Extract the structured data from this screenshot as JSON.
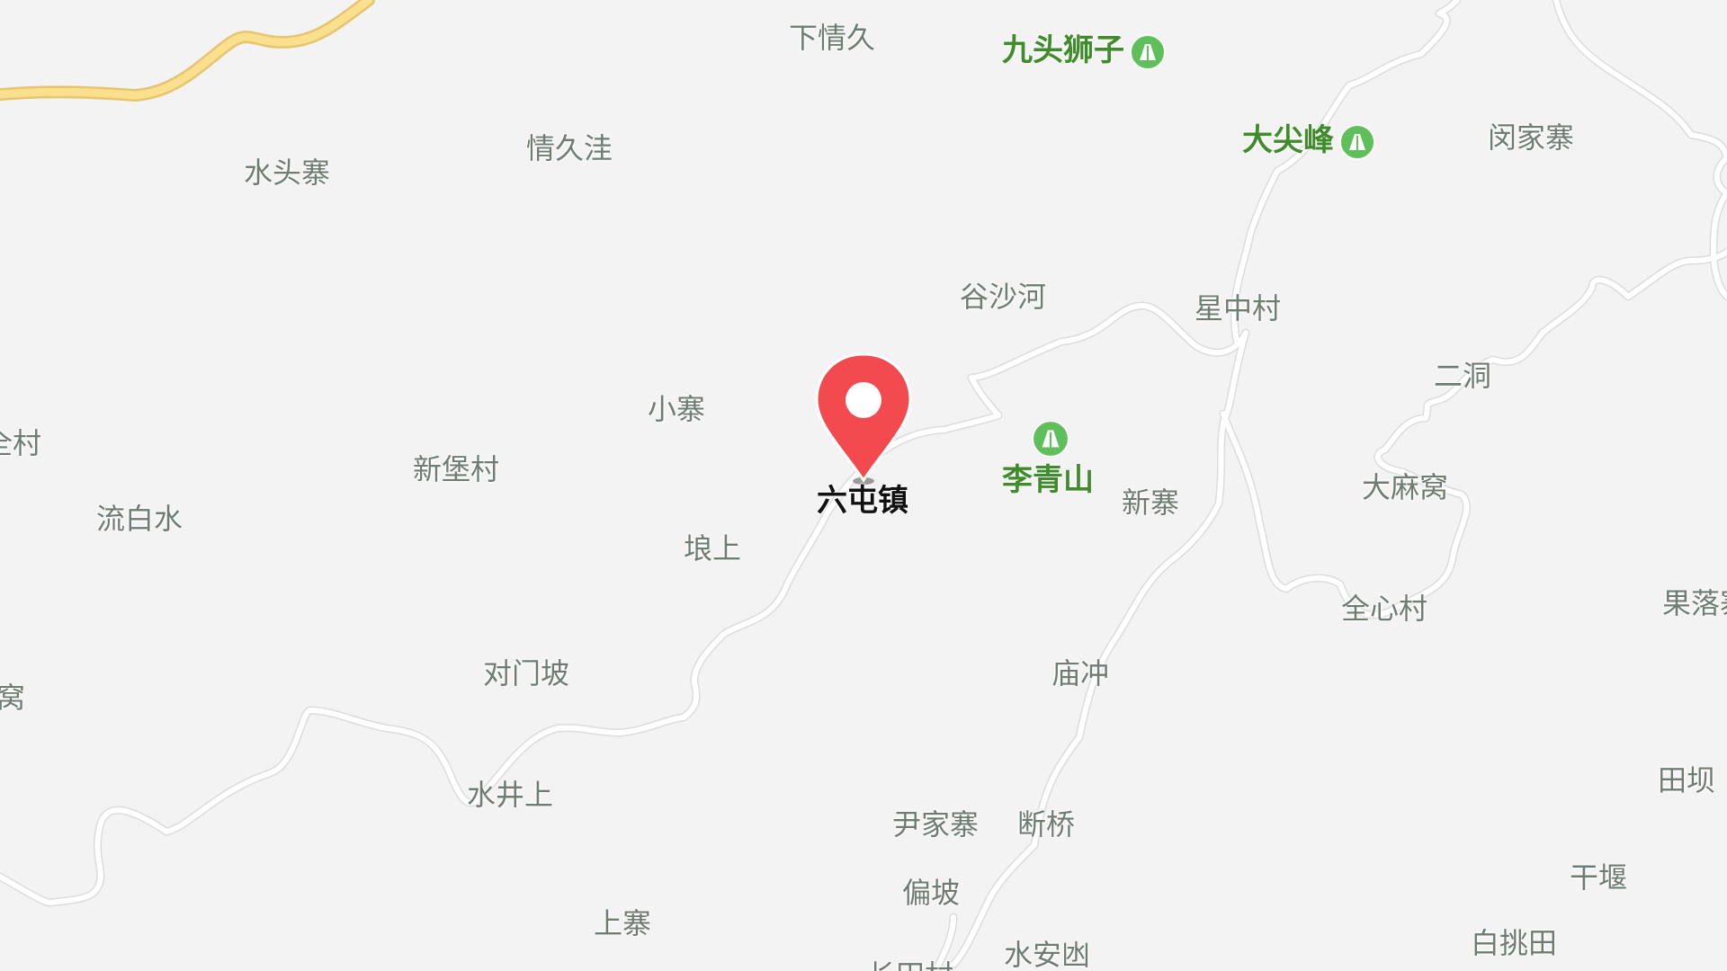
{
  "map": {
    "marker": {
      "label": "六屯镇",
      "color": "#f24a4f"
    },
    "colors": {
      "background": "#f3f3f3",
      "road_minor": "#ffffff",
      "road_major": "#f9df8e",
      "place_text": "#6f7c72",
      "peak_text": "#3e8c2a",
      "peak_icon": "#5fbf5a"
    },
    "places": [
      "下情久",
      "情久洼",
      "水头寨",
      "谷沙河",
      "星中村",
      "闵家寨",
      "小寨",
      "新堡村",
      "流白水",
      "全村",
      "二洞",
      "大麻窝",
      "新寨",
      "全心村",
      "埌上",
      "麻窝",
      "对门坡",
      "庙冲",
      "果落寨",
      "水井上",
      "尹家寨",
      "断桥",
      "田坝",
      "干堰",
      "偏坡",
      "上寨",
      "水安凼",
      "白挑田",
      "长田村"
    ],
    "peaks": [
      "九头狮子",
      "大尖峰",
      "李青山"
    ],
    "icons": {
      "peak": "mountain-icon",
      "marker": "location-pin-icon"
    }
  }
}
